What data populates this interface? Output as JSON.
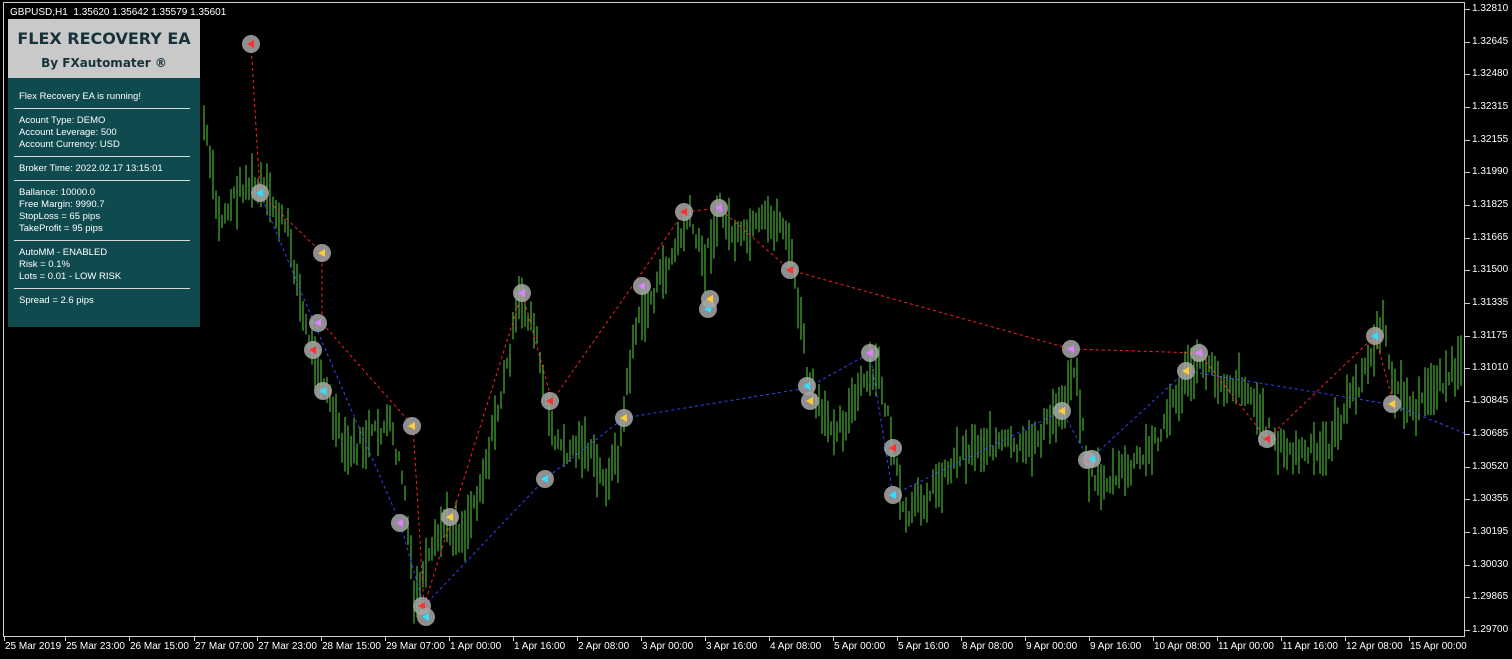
{
  "chart": {
    "symbol_header": "GBPUSD,H1  1.35620 1.35642 1.35579 1.35601",
    "price_axis": [
      "1.32810",
      "1.32645",
      "1.32480",
      "1.32315",
      "1.32155",
      "1.31990",
      "1.31825",
      "1.31665",
      "1.31500",
      "1.31335",
      "1.31175",
      "1.31010",
      "1.30845",
      "1.30685",
      "1.30520",
      "1.30355",
      "1.30195",
      "1.30030",
      "1.29865",
      "1.29700"
    ],
    "time_axis": [
      "25 Mar 2019",
      "25 Mar 23:00",
      "26 Mar 15:00",
      "27 Mar 07:00",
      "27 Mar 23:00",
      "28 Mar 15:00",
      "29 Mar 07:00",
      "1 Apr 00:00",
      "1 Apr 16:00",
      "2 Apr 08:00",
      "3 Apr 00:00",
      "3 Apr 16:00",
      "4 Apr 08:00",
      "5 Apr 00:00",
      "5 Apr 16:00",
      "8 Apr 08:00",
      "9 Apr 00:00",
      "9 Apr 16:00",
      "10 Apr 08:00",
      "11 Apr 00:00",
      "11 Apr 16:00",
      "12 Apr 08:00",
      "15 Apr 00:00"
    ],
    "colors": {
      "background": "#000000",
      "bars": "#55d63a",
      "buy_line": "#3344ff",
      "sell_line": "#ff2020",
      "marker_ring": "#a8a8a8"
    }
  },
  "ea_panel": {
    "title": "FLEX RECOVERY EA",
    "subtitle": "By FXautomater ®",
    "status": "Flex Recovery EA is running!",
    "account_type": "Acount Type:  DEMO",
    "account_leverage": "Account Leverage: 500",
    "account_currency": "Account Currency: USD",
    "broker_time": "Broker Time: 2022.02.17 13:15:01",
    "balance": "Ballance: 10000.0",
    "free_margin": "Free Margin: 9990.7",
    "stop_loss": "StopLoss = 65 pips",
    "take_profit": "TakeProfit = 95 pips",
    "automm": "AutoMM - ENABLED",
    "risk": "Risk = 0.1%",
    "lots": "Lots = 0.01 - LOW RISK",
    "spread": "Spread = 2.6 pips"
  }
}
